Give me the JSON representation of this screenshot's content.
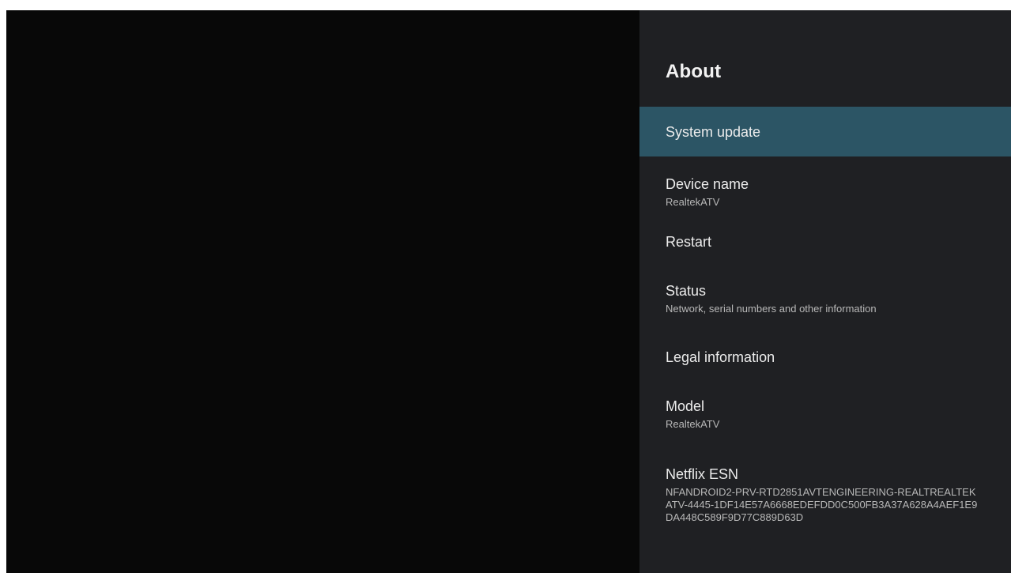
{
  "panel": {
    "title": "About",
    "items": [
      {
        "title": "System update",
        "subtitle": ""
      },
      {
        "title": "Device name",
        "subtitle": "RealtekATV"
      },
      {
        "title": "Restart",
        "subtitle": ""
      },
      {
        "title": "Status",
        "subtitle": "Network, serial numbers and other information"
      },
      {
        "title": "Legal information",
        "subtitle": ""
      },
      {
        "title": "Model",
        "subtitle": "RealtekATV"
      },
      {
        "title": "Netflix ESN",
        "subtitle": "NFANDROID2-PRV-RTD2851AVTENGINEERING-REALTREALTEKATV-4445-1DF14E57A6668EDEFDD0C500FB3A37A628A4AEF1E9DA448C589F9D77C889D63D"
      }
    ]
  },
  "colors": {
    "background": "#080808",
    "panel": "#1f2023",
    "selected": "#2c5565"
  }
}
